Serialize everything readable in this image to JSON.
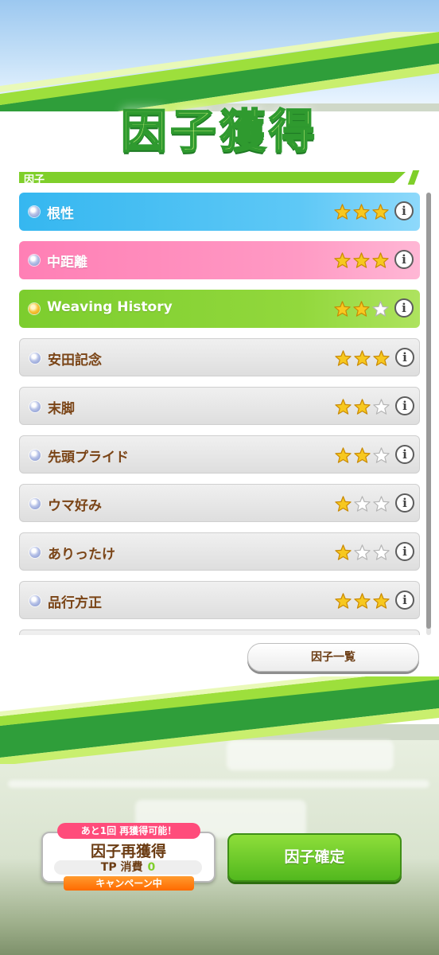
{
  "title": "因子獲得",
  "section_label": "因子",
  "factors": [
    {
      "name": "根性",
      "stars": 3,
      "max_stars": 3,
      "color": "blue",
      "dot": "silver"
    },
    {
      "name": "中距離",
      "stars": 3,
      "max_stars": 3,
      "color": "pink",
      "dot": "silver"
    },
    {
      "name": "Weaving History",
      "stars": 2,
      "max_stars": 3,
      "color": "green",
      "dot": "gold"
    },
    {
      "name": "安田記念",
      "stars": 3,
      "max_stars": 3,
      "color": "gray",
      "dot": "silver"
    },
    {
      "name": "末脚",
      "stars": 2,
      "max_stars": 3,
      "color": "gray",
      "dot": "silver"
    },
    {
      "name": "先頭プライド",
      "stars": 2,
      "max_stars": 3,
      "color": "gray",
      "dot": "silver"
    },
    {
      "name": "ウマ好み",
      "stars": 1,
      "max_stars": 3,
      "color": "gray",
      "dot": "silver"
    },
    {
      "name": "ありったけ",
      "stars": 1,
      "max_stars": 3,
      "color": "gray",
      "dot": "silver"
    },
    {
      "name": "品行方正",
      "stars": 3,
      "max_stars": 3,
      "color": "gray",
      "dot": "silver"
    }
  ],
  "info_glyph": "i",
  "factor_list_button": "因子一覧",
  "reacquire": {
    "badge": "あと1回 再獲得可能！",
    "label": "因子再獲得",
    "tp_label": "TP 消費",
    "tp_value": "0",
    "campaign": "キャンペーン中"
  },
  "confirm_button": "因子確定",
  "colors": {
    "accent_green": "#7fcf2a",
    "blue_row": "#35b7f0",
    "pink_row": "#ff7fb5",
    "green_row": "#7ccd2e",
    "badge_pink": "#ff4c7b",
    "campaign_orange": "#ff7a12",
    "text_brown": "#6b3c13"
  },
  "icons": [
    "star-filled-icon",
    "star-empty-icon",
    "info-icon",
    "gem-dot-icon"
  ]
}
